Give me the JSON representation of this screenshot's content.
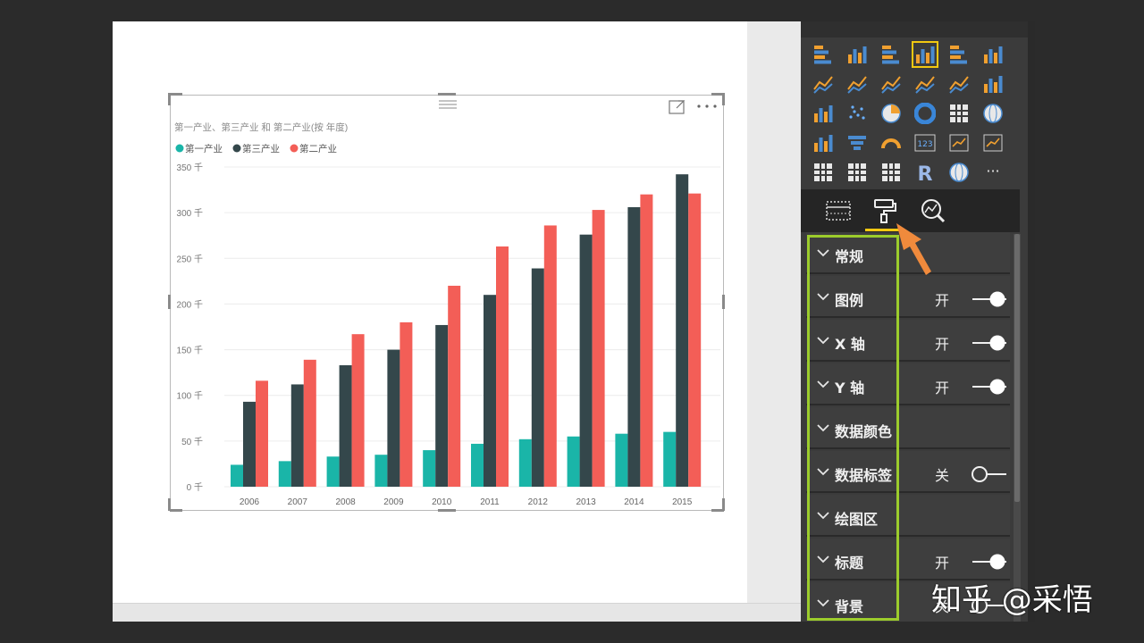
{
  "chart_data": {
    "type": "bar",
    "title": "第一产业、第三产业 和 第二产业(按 年度)",
    "categories": [
      "2006",
      "2007",
      "2008",
      "2009",
      "2010",
      "2011",
      "2012",
      "2013",
      "2014",
      "2015"
    ],
    "series": [
      {
        "name": "第一产业",
        "color": "#1ab5a8",
        "values": [
          24,
          28,
          33,
          35,
          40,
          47,
          52,
          55,
          58,
          60
        ]
      },
      {
        "name": "第三产业",
        "color": "#34474b",
        "values": [
          93,
          112,
          133,
          150,
          177,
          210,
          239,
          276,
          306,
          342
        ]
      },
      {
        "name": "第二产业",
        "color": "#f35e57",
        "values": [
          116,
          139,
          167,
          180,
          220,
          263,
          286,
          303,
          320,
          321
        ]
      }
    ],
    "ylim": [
      0,
      350
    ],
    "yticks": [
      "0 千",
      "50 千",
      "100 千",
      "150 千",
      "200 千",
      "250 千",
      "300 千",
      "350 千"
    ],
    "legend_position": "top-left",
    "grid": true
  },
  "visual_header": {
    "expand_icon": "focus-mode-icon",
    "more_icon": "more-options-icon"
  },
  "viz_icons": [
    "stacked-bar-icon",
    "stacked-column-icon",
    "clustered-bar-icon",
    "clustered-column-icon",
    "100-stacked-bar-icon",
    "100-stacked-column-icon",
    "line-chart-icon",
    "area-chart-icon",
    "stacked-area-icon",
    "line-clustered-column-icon",
    "line-stacked-column-icon",
    "ribbon-chart-icon",
    "waterfall-icon",
    "scatter-icon",
    "pie-icon",
    "donut-icon",
    "treemap-icon",
    "map-icon",
    "filled-map-icon",
    "funnel-icon",
    "gauge-icon",
    "card-icon",
    "multi-row-card-icon",
    "kpi-icon",
    "slicer-icon",
    "table-icon",
    "matrix-icon",
    "r-visual-icon",
    "globe-icon",
    "more-icon"
  ],
  "viz_card_text": "123",
  "viz_r_text": "R",
  "viz_more_text": "···",
  "pane_tabs": [
    "fields-icon",
    "format-paint-roller-icon",
    "analytics-icon"
  ],
  "sections": [
    {
      "label": "常规",
      "state": "",
      "toggle": null
    },
    {
      "label": "图例",
      "state": "开",
      "toggle": "on"
    },
    {
      "label": "X 轴",
      "state": "开",
      "toggle": "on"
    },
    {
      "label": "Y 轴",
      "state": "开",
      "toggle": "on"
    },
    {
      "label": "数据颜色",
      "state": "",
      "toggle": null
    },
    {
      "label": "数据标签",
      "state": "关",
      "toggle": "off"
    },
    {
      "label": "绘图区",
      "state": "",
      "toggle": null
    },
    {
      "label": "标题",
      "state": "开",
      "toggle": "on"
    },
    {
      "label": "背景",
      "state": "关",
      "toggle": "off"
    }
  ],
  "colors": {
    "highlight_green": "#9ccc2c",
    "arrow_orange": "#f08a3c",
    "selected_yellow": "#f2c811"
  },
  "watermark": "知乎 @采悟"
}
